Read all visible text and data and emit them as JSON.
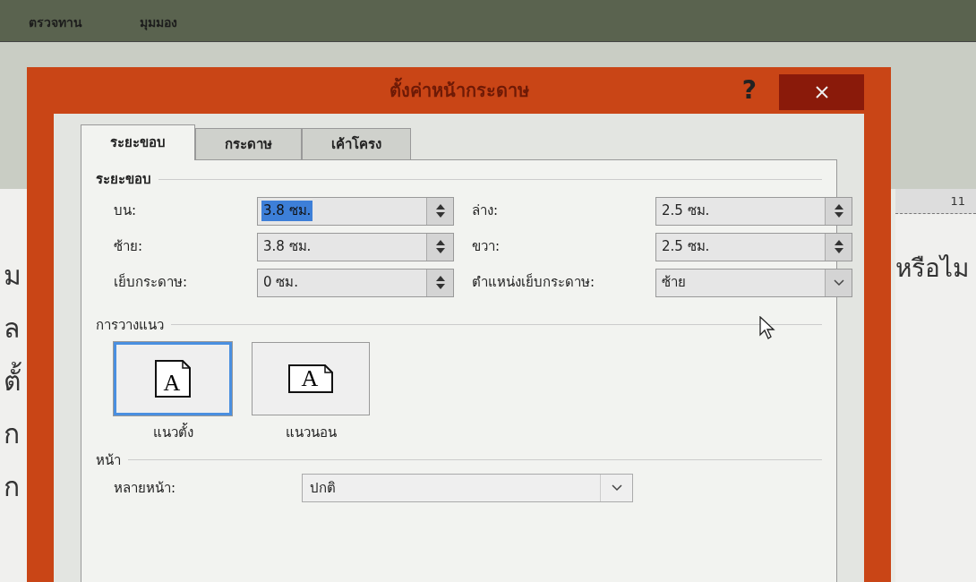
{
  "ribbon_tabs": [
    {
      "label": "ตรวจทาน"
    },
    {
      "label": "มุมมอง"
    }
  ],
  "document": {
    "left_fragments": [
      "ม",
      "ล",
      "ตั้",
      "ก",
      "ก"
    ],
    "right_fragment": "หรือไม",
    "ruler_number": "11"
  },
  "dialog": {
    "title": "ตั้งค่าหน้ากระดาษ",
    "help": "?",
    "tabs": [
      {
        "label": "ระยะขอบ",
        "selected": true
      },
      {
        "label": "กระดาษ",
        "selected": false
      },
      {
        "label": "เค้าโครง",
        "selected": false
      }
    ],
    "margins": {
      "heading": "ระยะขอบ",
      "fields": [
        {
          "label": "บน:",
          "value": "3.8 ซม.",
          "kind": "spin",
          "text_selected": true
        },
        {
          "label": "ล่าง:",
          "value": "2.5 ซม.",
          "kind": "spin",
          "text_selected": false
        },
        {
          "label": "ซ้าย:",
          "value": "3.8 ซม.",
          "kind": "spin",
          "text_selected": false
        },
        {
          "label": "ขวา:",
          "value": "2.5 ซม.",
          "kind": "spin",
          "text_selected": false
        },
        {
          "label": "เย็บกระดาษ:",
          "value": "0 ซม.",
          "kind": "spin",
          "text_selected": false
        },
        {
          "label": "ตำแหน่งเย็บกระดาษ:",
          "value": "ซ้าย",
          "kind": "dropdown",
          "text_selected": false
        }
      ]
    },
    "orientation": {
      "heading": "การวางแนว",
      "options": [
        {
          "label": "แนวตั้ง",
          "kind": "portrait",
          "icon_letter": "A",
          "selected": true
        },
        {
          "label": "แนวนอน",
          "kind": "landscape",
          "icon_letter": "A",
          "selected": false
        }
      ]
    },
    "pages": {
      "heading": "หน้า",
      "label": "หลายหน้า:",
      "value": "ปกติ"
    }
  }
}
